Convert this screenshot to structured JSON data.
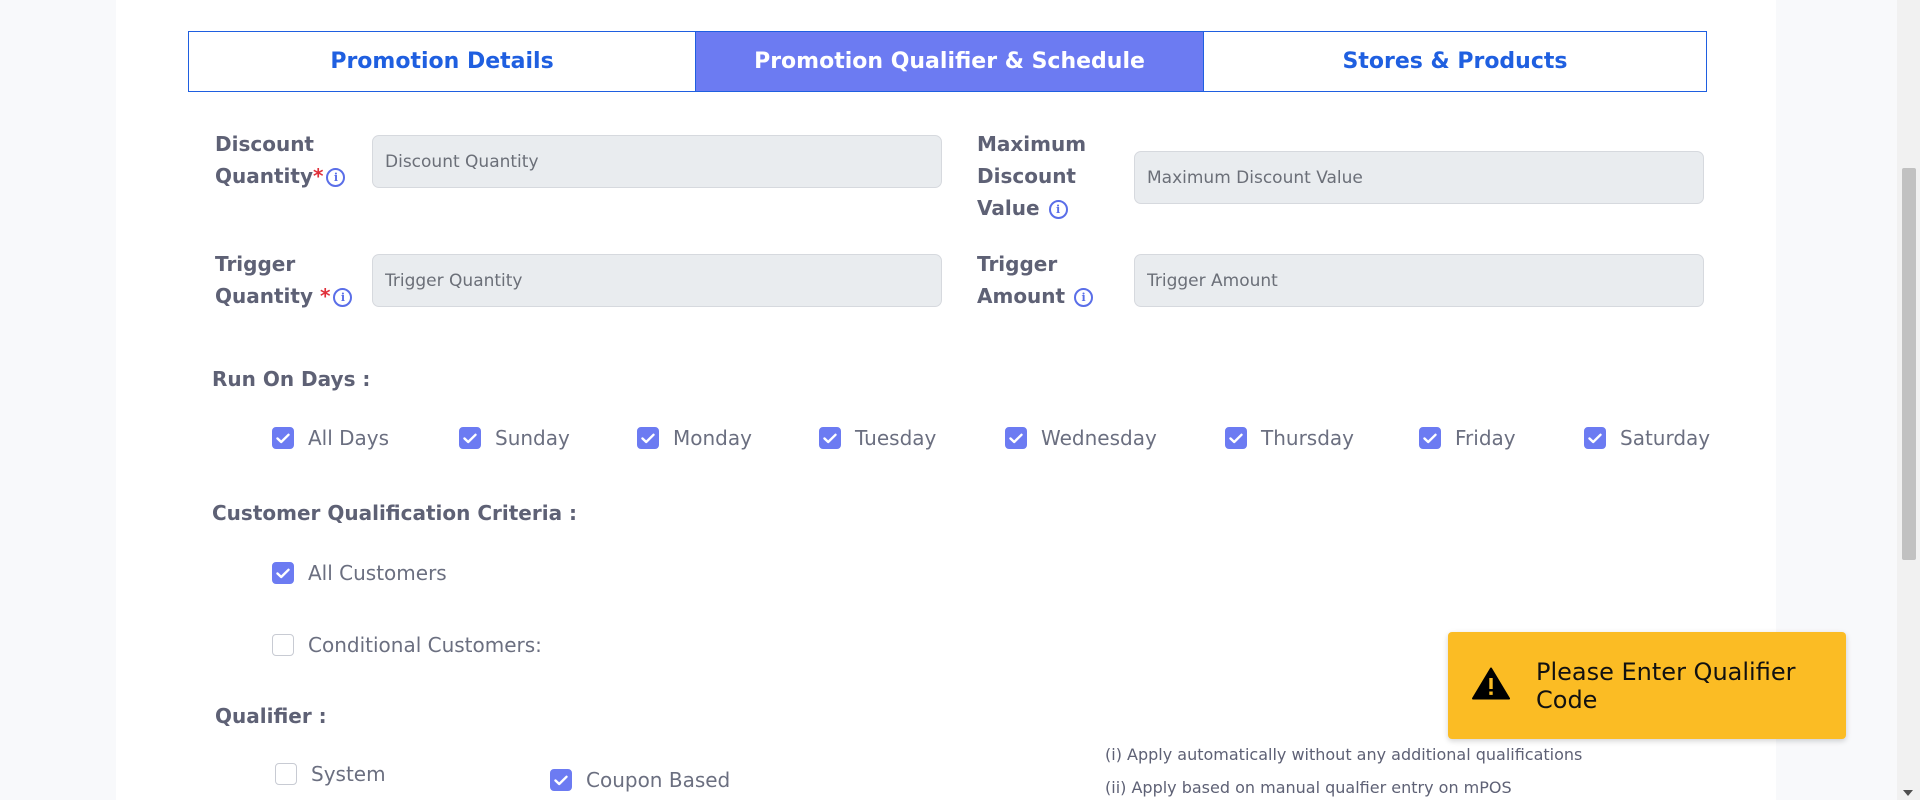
{
  "tabs": [
    {
      "label": "Promotion Details",
      "active": false
    },
    {
      "label": "Promotion Qualifier & Schedule",
      "active": true
    },
    {
      "label": "Stores & Products",
      "active": false
    }
  ],
  "fields": {
    "discount_quantity": {
      "label_line1": "Discount",
      "label_line2": "Quantity",
      "required": "*",
      "placeholder": "Discount Quantity"
    },
    "max_discount_value": {
      "label_line1": "Maximum",
      "label_line2": "Discount",
      "label_line3": "Value",
      "placeholder": "Maximum Discount Value"
    },
    "trigger_quantity": {
      "label_line1": "Trigger",
      "label_line2": "Quantity",
      "required": "*",
      "placeholder": "Trigger Quantity"
    },
    "trigger_amount": {
      "label_line1": "Trigger",
      "label_line2": "Amount",
      "placeholder": "Trigger Amount"
    }
  },
  "info_glyph": "i",
  "run_on_days": {
    "title": "Run On Days :",
    "days": [
      {
        "label": "All Days",
        "checked": true
      },
      {
        "label": "Sunday",
        "checked": true
      },
      {
        "label": "Monday",
        "checked": true
      },
      {
        "label": "Tuesday",
        "checked": true
      },
      {
        "label": "Wednesday",
        "checked": true
      },
      {
        "label": "Thursday",
        "checked": true
      },
      {
        "label": "Friday",
        "checked": true
      },
      {
        "label": "Saturday",
        "checked": true
      }
    ]
  },
  "customer_criteria": {
    "title": "Customer Qualification Criteria :",
    "options": [
      {
        "label": "All Customers",
        "checked": true
      },
      {
        "label": "Conditional Customers:",
        "checked": false
      }
    ]
  },
  "qualifier": {
    "title": "Qualifier :",
    "options": [
      {
        "label": "System",
        "checked": false
      },
      {
        "label": "Coupon Based",
        "checked": true
      }
    ],
    "notes": [
      "(i) Apply automatically without any additional qualifications",
      "(ii) Apply based on manual qualfier entry on mPOS"
    ]
  },
  "toast": {
    "message": "Please Enter Qualifier Code",
    "icon": "warning-icon"
  },
  "colors": {
    "accent": "#6c7bf2",
    "tab_text": "#1f5fe0",
    "toast_bg": "#fbbc24",
    "required": "#e0303a"
  }
}
